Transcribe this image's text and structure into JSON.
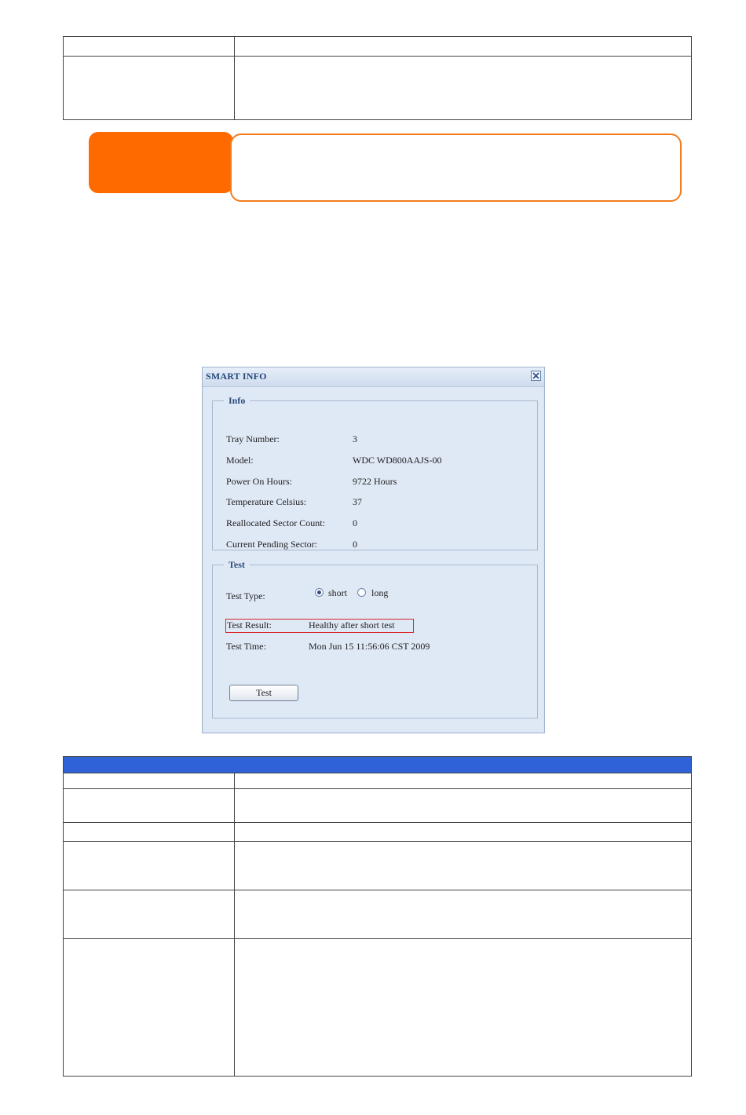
{
  "window": {
    "title": "SMART INFO",
    "info_group": {
      "legend": "Info",
      "rows": [
        {
          "label": "Tray Number:",
          "value": "3"
        },
        {
          "label": "Model:",
          "value": "WDC WD800AAJS-00"
        },
        {
          "label": "Power On Hours:",
          "value": "9722 Hours"
        },
        {
          "label": "Temperature Celsius:",
          "value": "37"
        },
        {
          "label": "Reallocated Sector Count:",
          "value": "0"
        },
        {
          "label": "Current Pending Sector:",
          "value": "0"
        }
      ]
    },
    "test_group": {
      "legend": "Test",
      "type_label": "Test Type:",
      "options": [
        {
          "label": "short",
          "selected": true
        },
        {
          "label": "long",
          "selected": false
        }
      ],
      "result_label": "Test Result:",
      "result_value": "Healthy after short test",
      "time_label": "Test Time:",
      "time_value": "Mon Jun 15 11:56:06 CST 2009",
      "button_label": "Test"
    }
  },
  "colors": {
    "note_tab": "#ff6a00",
    "note_border": "#f07c1e",
    "table_header": "#2e62d6",
    "highlight": "#d8262c"
  }
}
